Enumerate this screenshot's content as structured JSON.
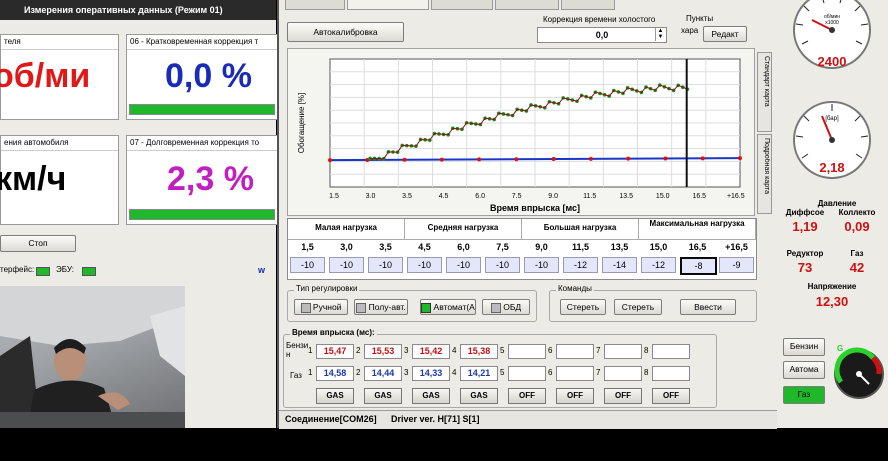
{
  "left": {
    "title": "Измерения оперативных данных (Режим 01)",
    "panels": [
      {
        "header": "теля",
        "value": "об/ми"
      },
      {
        "header": "06 - Кратковременная коррекция т",
        "value": "0,0 %"
      },
      {
        "header": "ения автомобиля",
        "value": "км/ч"
      },
      {
        "header": "07 - Долговременная коррекция то",
        "value": "2,3 %"
      }
    ],
    "bar_fill_percent": [
      100,
      100
    ],
    "stop_button": "Стоп",
    "status": [
      {
        "label": "терфейс:"
      },
      {
        "label": "ЭБУ:"
      }
    ],
    "status_letter": "w"
  },
  "main": {
    "autocalib_button": "Автокалибровка",
    "idle_correction": {
      "label": "Коррекция времени холостого",
      "value": "0,0"
    },
    "points": {
      "label": "Пункты",
      "sublabel": "хара",
      "button": "Редакт"
    },
    "side_tabs": [
      "Стандарт карта",
      "Подробная карта"
    ],
    "chart": {
      "ylabel": "Обогащение [%]",
      "xlabel": "Время впрыска [мс]",
      "xticks": [
        "1.5",
        "3.0",
        "3.5",
        "4.5",
        "6.0",
        "7.5",
        "9.0",
        "11.5",
        "13.5",
        "15.0",
        "16.5",
        "+16.5"
      ]
    },
    "load_table": {
      "groups": [
        "Малая  нагрузка",
        "Средняя нагрузка",
        "Большая нагрузка",
        "Максимальная нагрузка"
      ],
      "times": [
        "1,5",
        "3,0",
        "3,5",
        "4,5",
        "6,0",
        "7,5",
        "9,0",
        "11,5",
        "13,5",
        "15,0",
        "16,5",
        "+16,5"
      ],
      "corrections": [
        "-10",
        "-10",
        "-10",
        "-10",
        "-10",
        "-10",
        "-10",
        "-12",
        "-14",
        "-12",
        "-8",
        "-9"
      ]
    },
    "regulation": {
      "legend": "Тип регулировки",
      "buttons": [
        "Ручной",
        "Полу-авт.",
        "Автомат(А",
        "ОБД"
      ]
    },
    "commands": {
      "legend": "Команды",
      "buttons": [
        "Стерeть",
        "Стерeть",
        "Ввести"
      ]
    },
    "injection": {
      "legend": "Время впрыска (мс):",
      "row1_label": "Бензи н",
      "row2_label": "Газ",
      "slots": [
        "1",
        "2",
        "3",
        "4",
        "5",
        "6",
        "7",
        "8"
      ],
      "petrol": [
        "15,47",
        "15,53",
        "15,42",
        "15,38",
        "",
        "",
        "",
        ""
      ],
      "gas": [
        "14,58",
        "14,44",
        "14,33",
        "14,21",
        "",
        "",
        "",
        ""
      ],
      "buttons": [
        "GAS",
        "GAS",
        "GAS",
        "GAS",
        "OFF",
        "OFF",
        "OFF",
        "OFF"
      ]
    },
    "statusbar": {
      "connection": "Соединение[COM26]",
      "driver": "Driver ver. H[71] S[1]"
    }
  },
  "right": {
    "rpm_gauge": {
      "unit": "об/мин x1000",
      "value": "2400"
    },
    "pressure_gauge": {
      "unit": "[бар]",
      "value": "2,18"
    },
    "pressure": {
      "title": "Давление",
      "cols": [
        {
          "label": "Диффсое",
          "value": "1,19"
        },
        {
          "label": "Коллекто",
          "value": "0,09"
        }
      ]
    },
    "temps": [
      {
        "label": "Редуктор",
        "value": "73"
      },
      {
        "label": "Газ",
        "value": "42"
      }
    ],
    "voltage": {
      "label": "Напряжение",
      "value": "12,30"
    },
    "mode_buttons": [
      "Бензин",
      "Автома",
      "Газ"
    ],
    "level_letter": "G"
  }
}
